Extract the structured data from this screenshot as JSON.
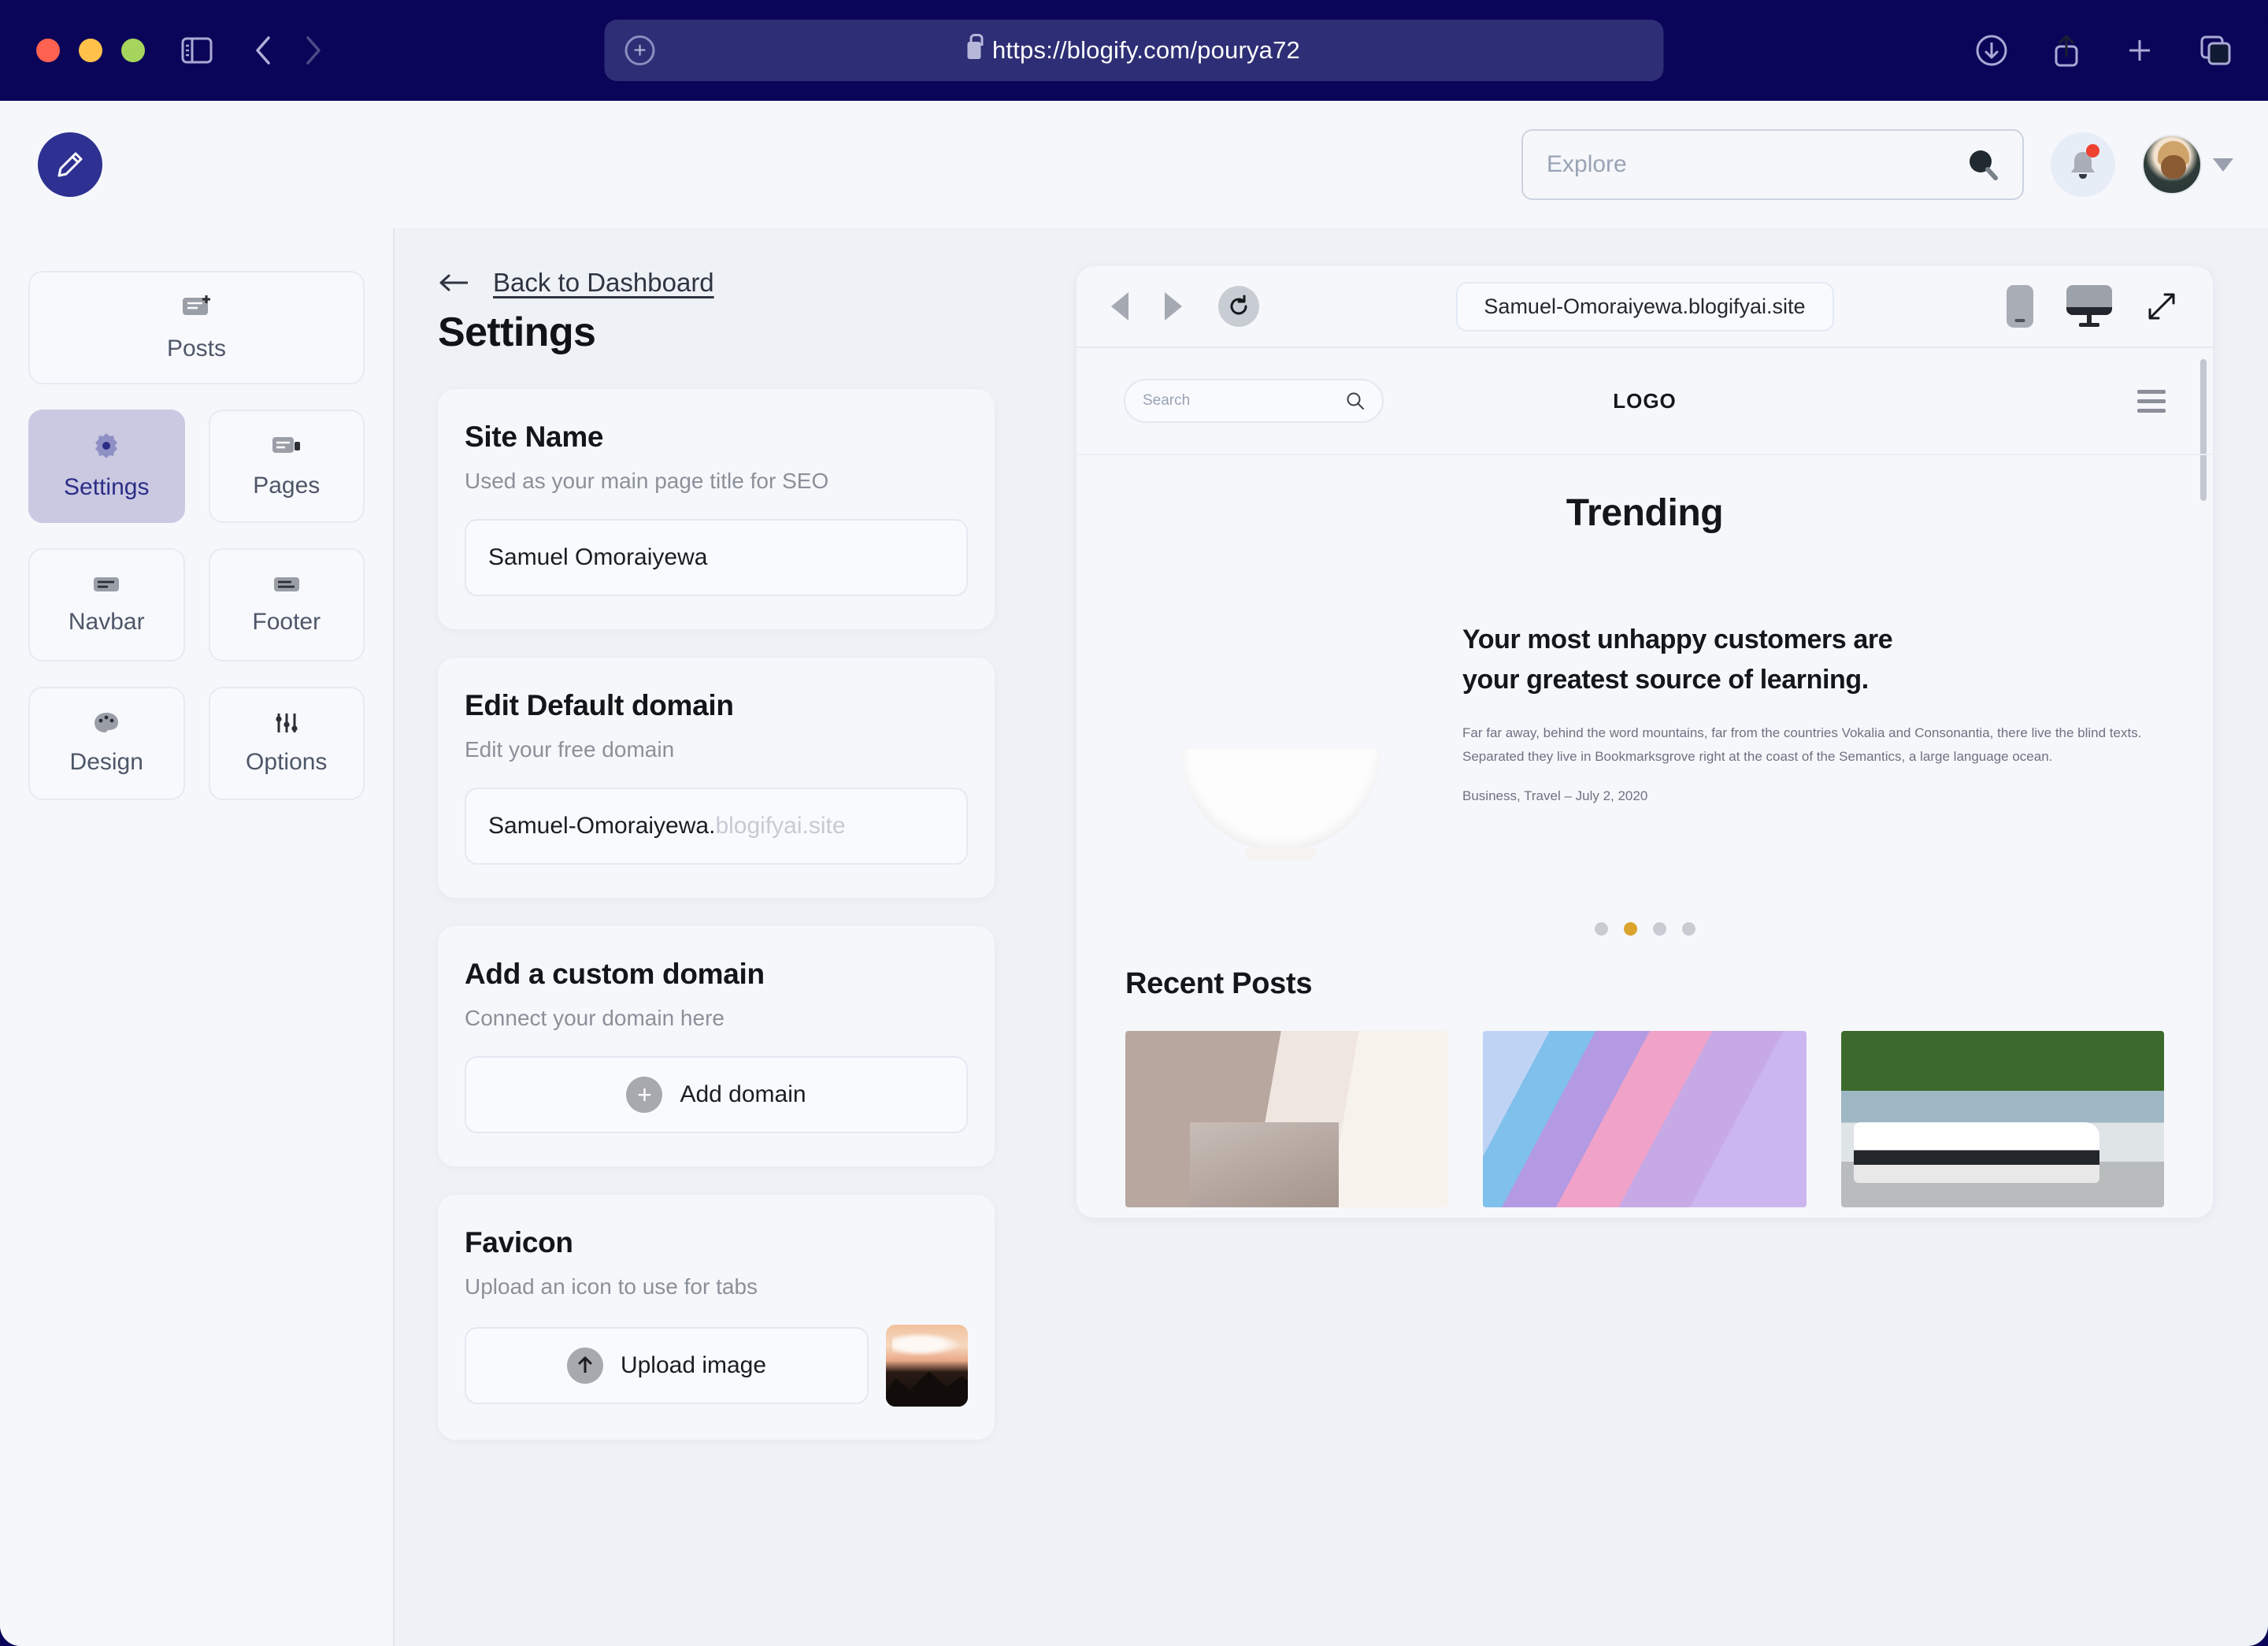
{
  "browser": {
    "url": "https://blogify.com/pourya72",
    "icons": {
      "sidebar": "sidebar-toggle-icon",
      "back": "back-chevron-icon",
      "forward": "forward-chevron-icon",
      "new_tab": "plus-icon",
      "download": "download-icon",
      "share": "share-icon",
      "add_tab": "add-tab-icon",
      "tabs": "tabs-icon",
      "lock": "lock-icon"
    }
  },
  "topbar": {
    "brand_icon": "pencil-icon",
    "search": {
      "placeholder": "Explore",
      "value": ""
    },
    "notification_badge": true
  },
  "sidebar": {
    "tiles": [
      {
        "label": "Posts",
        "icon": "post-add-icon",
        "active": false,
        "wide": true
      },
      {
        "label": "Settings",
        "icon": "gear-icon",
        "active": true,
        "wide": false
      },
      {
        "label": "Pages",
        "icon": "pages-icon",
        "active": false,
        "wide": false
      },
      {
        "label": "Navbar",
        "icon": "navbar-icon",
        "active": false,
        "wide": false
      },
      {
        "label": "Footer",
        "icon": "footer-icon",
        "active": false,
        "wide": false
      },
      {
        "label": "Design",
        "icon": "palette-icon",
        "active": false,
        "wide": false
      },
      {
        "label": "Options",
        "icon": "sliders-icon",
        "active": false,
        "wide": false
      }
    ]
  },
  "settings": {
    "back_label": "Back to Dashboard",
    "back_icon": "arrow-left-icon",
    "title": "Settings",
    "cards": [
      {
        "title": "Site Name",
        "subtitle": "Used as your main page title for SEO",
        "value": "Samuel Omoraiyewa"
      },
      {
        "title": "Edit Default domain",
        "subtitle": "Edit your free domain",
        "value": "Samuel-Omoraiyewa.",
        "suffix": "blogifyai.site"
      },
      {
        "title": "Add a custom domain",
        "subtitle": "Connect your domain here",
        "action_label": "Add domain",
        "action_icon": "plus-circle-icon"
      },
      {
        "title": "Favicon",
        "subtitle": "Upload an icon to use for tabs",
        "action_label": "Upload image",
        "action_icon": "upload-circle-icon",
        "thumbnail": "favicon-preview"
      }
    ]
  },
  "preview": {
    "toolbar": {
      "back_icon": "preview-back-icon",
      "forward_icon": "preview-forward-icon",
      "reload_icon": "reload-icon",
      "url": "Samuel-Omoraiyewa.blogifyai.site",
      "mobile_icon": "mobile-device-icon",
      "desktop_icon": "desktop-device-icon",
      "expand_icon": "expand-arrows-icon",
      "active_device": "desktop"
    },
    "site": {
      "search_placeholder": "Search",
      "search_icon": "search-icon",
      "logo": "LOGO",
      "menu_icon": "hamburger-icon",
      "trending_heading": "Trending",
      "hero": {
        "title_line1": "Your most unhappy customers are",
        "title_line2": "your greatest source of learning.",
        "body_line1": "Far far away, behind the word mountains, far from the countries Vokalia and Consonantia, there live the blind texts.",
        "body_line2": "Separated they live in Bookmarksgrove right at the coast of the Semantics, a large language ocean.",
        "meta": "Business, Travel – July 2, 2020",
        "image": "fruit-bowl-photo"
      },
      "carousel": {
        "count": 4,
        "active_index": 1,
        "active_color": "#dca42c",
        "inactive_color": "#c8cbd2"
      },
      "recent_heading": "Recent Posts",
      "recent_thumbs": [
        "bedroom-lamp-photo",
        "abstract-ribbons-photo",
        "white-car-photo"
      ]
    }
  },
  "colors": {
    "chrome_bg": "#0b0559",
    "url_pill": "#2e2e76",
    "brand": "#2e3191",
    "active_tile_bg": "#cbc9e2",
    "active_tile_text": "#2b2d86",
    "app_bg": "#eef1f6",
    "panel_bg": "#f5f7fb",
    "accent_gold": "#dca42c",
    "badge_red": "#ef4130"
  }
}
